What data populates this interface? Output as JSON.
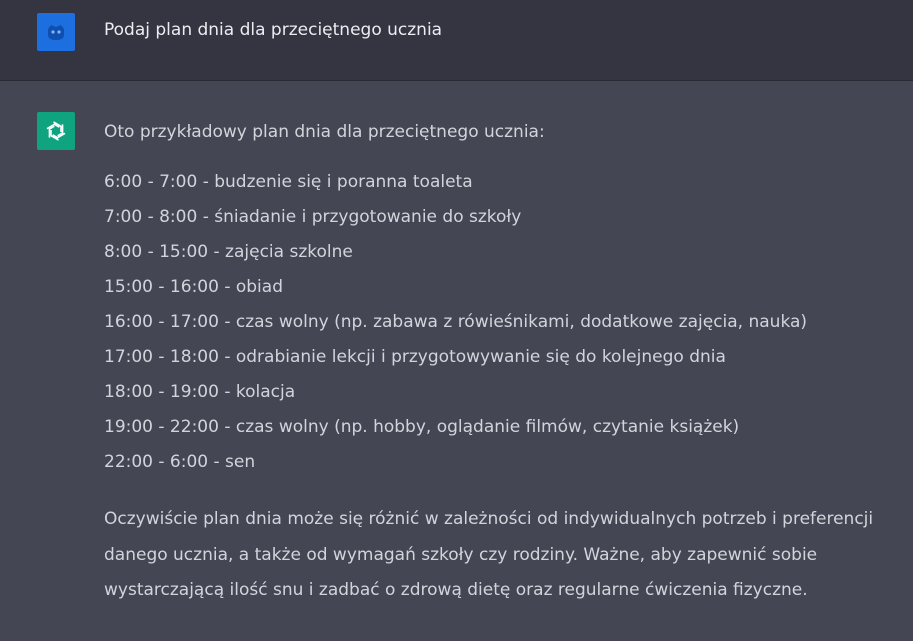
{
  "user_message": {
    "avatar_icon": "user-avatar-icon",
    "text": "Podaj plan dnia dla przeciętnego ucznia"
  },
  "assistant_message": {
    "avatar_icon": "openai-logo-icon",
    "intro": "Oto przykładowy plan dnia dla przeciętnego ucznia:",
    "schedule": [
      "6:00 - 7:00 - budzenie się i poranna toaleta",
      "7:00 - 8:00 - śniadanie i przygotowanie do szkoły",
      "8:00 - 15:00 - zajęcia szkolne",
      "15:00 - 16:00 - obiad",
      "16:00 - 17:00 - czas wolny (np. zabawa z rówieśnikami, dodatkowe zajęcia, nauka)",
      "17:00 - 18:00 - odrabianie lekcji i przygotowywanie się do kolejnego dnia",
      "18:00 - 19:00 - kolacja",
      "19:00 - 22:00 - czas wolny (np. hobby, oglądanie filmów, czytanie książek)",
      "22:00 - 6:00 - sen"
    ],
    "outro": "Oczywiście plan dnia może się różnić w zależności od indywidualnych potrzeb i preferencji danego ucznia, a także od wymagań szkoły czy rodziny. Ważne, aby zapewnić sobie wystarczającą ilość snu i zadbać o zdrową dietę oraz regularne ćwiczenia fizyczne."
  },
  "colors": {
    "user_row_bg": "#343541",
    "assistant_row_bg": "#444654",
    "user_avatar_bg": "#1d6fe0",
    "assistant_avatar_bg": "#10a37f"
  }
}
